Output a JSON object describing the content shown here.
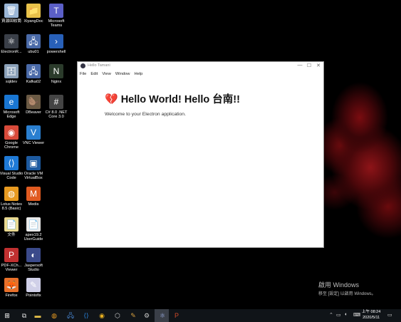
{
  "desktop": {
    "icons": [
      {
        "label": "資源回收筒",
        "color": "#9ab6d6",
        "glyph": "🗑"
      },
      {
        "label": "XiyangDoc",
        "color": "#e8c24a",
        "glyph": "📁"
      },
      {
        "label": "Microsoft Teams",
        "color": "#5b5fc7",
        "glyph": "T"
      },
      {
        "label": "ElectronR...",
        "color": "#3a3f48",
        "glyph": "⚛"
      },
      {
        "label": "ubu01",
        "color": "#4a6aa8",
        "glyph": "🖧"
      },
      {
        "label": "powershell",
        "color": "#2860b8",
        "glyph": "›"
      },
      {
        "label": "sqldev",
        "color": "#8aa0b8",
        "glyph": "🗄"
      },
      {
        "label": "Kafka02",
        "color": "#4a6aa8",
        "glyph": "🖧"
      },
      {
        "label": "Nginx",
        "color": "#2b3b2b",
        "glyph": "N"
      },
      {
        "label": "Microsoft Edge",
        "color": "#1976d2",
        "glyph": "e"
      },
      {
        "label": "DBeaver",
        "color": "#6b5a44",
        "glyph": "🦫"
      },
      {
        "label": "C# 8.0 .NET Core 3.0",
        "color": "#444",
        "glyph": "#"
      },
      {
        "label": "Google Chrome",
        "color": "#d84a3a",
        "glyph": "◉"
      },
      {
        "label": "VNC Viewer",
        "color": "#2a7fd0",
        "glyph": "V"
      },
      {
        "label": "Visual Studio Code",
        "color": "#1f7ad6",
        "glyph": "⟨⟩"
      },
      {
        "label": "Oracle VM VirtualBox",
        "color": "#1d5aa0",
        "glyph": "▣"
      },
      {
        "label": "Lotus Notes 8.5 (Basic)",
        "color": "#e89a20",
        "glyph": "◍"
      },
      {
        "label": "Medis",
        "color": "#e05a20",
        "glyph": "M"
      },
      {
        "label": "文件",
        "color": "#e8d890",
        "glyph": "📄"
      },
      {
        "label": "apex19.2 UserGuide",
        "color": "#e8e8e8",
        "glyph": "📄"
      },
      {
        "label": "PDF-XCh... Viewer",
        "color": "#c03030",
        "glyph": "P"
      },
      {
        "label": "Jaspersoft Studio",
        "color": "#3b4a8a",
        "glyph": "◐"
      },
      {
        "label": "Firefox",
        "color": "#e8702a",
        "glyph": "🦊"
      },
      {
        "label": "Pointofix",
        "color": "#d0d0e8",
        "glyph": "✎"
      }
    ]
  },
  "window": {
    "title": "Hello Tamani",
    "menu": [
      "File",
      "Edit",
      "View",
      "Window",
      "Help"
    ],
    "heading_emoji": "💔",
    "heading": "Hello World! Hello 台南!!",
    "body": "Welcome to your Electron application.",
    "controls": {
      "minimize": "—",
      "maximize": "☐",
      "close": "✕"
    }
  },
  "watermark": {
    "line1": "啟用 Windows",
    "line2": "移至 [設定] 以啟用 Windows。"
  },
  "taskbar": {
    "start_glyph": "⊞",
    "time": "上午 08:24",
    "date": "2020/5/11",
    "apps": [
      {
        "name": "task-view",
        "glyph": "⧉",
        "color": "#ddd"
      },
      {
        "name": "file-explorer",
        "glyph": "▬",
        "color": "#e8c24a"
      },
      {
        "name": "lotus",
        "glyph": "◍",
        "color": "#e89a20"
      },
      {
        "name": "network",
        "glyph": "🖧",
        "color": "#4a8ad8"
      },
      {
        "name": "vscode",
        "glyph": "⟨⟩",
        "color": "#2a8ae8"
      },
      {
        "name": "chrome",
        "glyph": "◉",
        "color": "#e8b020"
      },
      {
        "name": "unity",
        "glyph": "⬡",
        "color": "#ccc"
      },
      {
        "name": "tools",
        "glyph": "✎",
        "color": "#d8a040"
      },
      {
        "name": "settings",
        "glyph": "⚙",
        "color": "#ccc"
      },
      {
        "name": "electron",
        "glyph": "⚛",
        "color": "#9ad"
      },
      {
        "name": "powerpoint",
        "glyph": "P",
        "color": "#d04a2a"
      }
    ]
  }
}
